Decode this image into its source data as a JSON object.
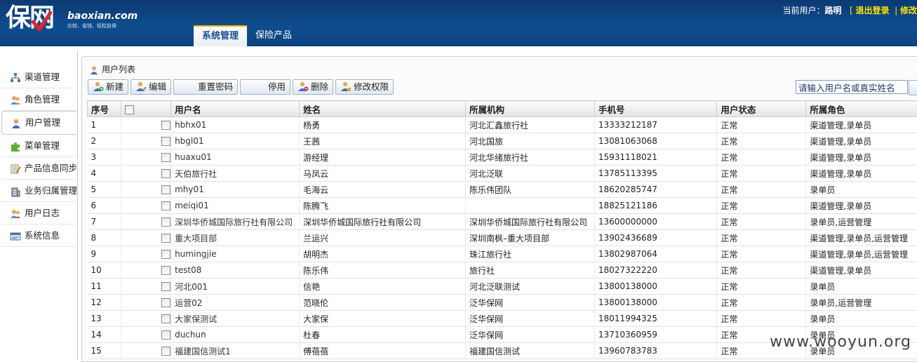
{
  "header": {
    "logo_cn": "保网",
    "logo_en": "baoxian.com",
    "slogan": "比较、省钱、轻松投保",
    "current_user_label": "当前用户：",
    "current_user": "路明",
    "logout": "退出登录",
    "modify_truncated": "修改"
  },
  "nav_tabs": [
    {
      "label": "系统管理",
      "active": true
    },
    {
      "label": "保险产品",
      "active": false
    }
  ],
  "sidebar": {
    "items": [
      {
        "label": "渠道管理",
        "icon": "org-chart-icon"
      },
      {
        "label": "角色管理",
        "icon": "users-icon"
      },
      {
        "label": "用户管理",
        "icon": "user-icon",
        "active": true
      },
      {
        "label": "菜单管理",
        "icon": "puzzle-icon"
      },
      {
        "label": "产品信息同步",
        "icon": "edit-note-icon"
      },
      {
        "label": "业务归属管理",
        "icon": "building-icon"
      },
      {
        "label": "用户日志",
        "icon": "user-log-icon"
      },
      {
        "label": "系统信息",
        "icon": "system-info-icon"
      }
    ]
  },
  "panel": {
    "title": "用户列表",
    "toolbar": {
      "new": "新建",
      "edit": "编辑",
      "reset_password": "重置密码",
      "disable": "停用",
      "delete": "删除",
      "edit_permission": "修改权限"
    },
    "search_placeholder": "请输入用户名或真实姓名"
  },
  "table": {
    "columns": [
      "序号",
      "",
      "用户名",
      "姓名",
      "所属机构",
      "手机号",
      "用户状态",
      "所属角色"
    ],
    "rows": [
      {
        "no": "1",
        "username": "hbhx01",
        "name": "杨勇",
        "org": "河北汇鑫旅行社",
        "phone": "13333212187",
        "status": "正常",
        "role": "渠道管理,录单员"
      },
      {
        "no": "2",
        "username": "hbgl01",
        "name": "王茜",
        "org": "河北国旅",
        "phone": "13081063068",
        "status": "正常",
        "role": "渠道管理,录单员"
      },
      {
        "no": "3",
        "username": "huaxu01",
        "name": "游经理",
        "org": "河北华绪旅行社",
        "phone": "15931118021",
        "status": "正常",
        "role": "渠道管理,录单员"
      },
      {
        "no": "4",
        "username": "天伯旅行社",
        "name": "马凤云",
        "org": "河北泛联",
        "phone": "13785113395",
        "status": "正常",
        "role": "渠道管理,录单员"
      },
      {
        "no": "5",
        "username": "mhy01",
        "name": "毛海云",
        "org": "陈乐伟团队",
        "phone": "18620285747",
        "status": "正常",
        "role": "录单员"
      },
      {
        "no": "6",
        "username": "meiqi01",
        "name": "陈腾飞",
        "org": "",
        "phone": "18825121186",
        "status": "正常",
        "role": "渠道管理,录单员"
      },
      {
        "no": "7",
        "username": "深圳华侨城国际旅行社有限公司",
        "name": "深圳华侨城国际旅行社有限公司",
        "org": "深圳华侨城国际旅行社有限公司",
        "phone": "13600000000",
        "status": "正常",
        "role": "录单员,运营管理"
      },
      {
        "no": "8",
        "username": "重大项目部",
        "name": "兰运兴",
        "org": "深圳南枫–重大项目部",
        "phone": "13902436689",
        "status": "正常",
        "role": "渠道管理,录单员,运营管理"
      },
      {
        "no": "9",
        "username": "humingjie",
        "name": "胡明杰",
        "org": "珠江旅行社",
        "phone": "13802987064",
        "status": "正常",
        "role": "渠道管理,录单员,运营管理"
      },
      {
        "no": "10",
        "username": "test08",
        "name": "陈乐伟",
        "org": "旅行社",
        "phone": "18027322220",
        "status": "正常",
        "role": "渠道管理,录单员"
      },
      {
        "no": "11",
        "username": "河北001",
        "name": "信艳",
        "org": "河北泛联测试",
        "phone": "13800138000",
        "status": "正常",
        "role": "录单员"
      },
      {
        "no": "12",
        "username": "运营02",
        "name": "范晓伦",
        "org": "泛华保网",
        "phone": "13800138000",
        "status": "正常",
        "role": "录单员,运营管理"
      },
      {
        "no": "13",
        "username": "大家保测试",
        "name": "大家保",
        "org": "泛华保网",
        "phone": "18011994325",
        "status": "正常",
        "role": "录单员"
      },
      {
        "no": "14",
        "username": "duchun",
        "name": "杜春",
        "org": "泛华保网",
        "phone": "13710360959",
        "status": "正常",
        "role": "录单员"
      },
      {
        "no": "15",
        "username": "福建国信测试1",
        "name": "傅蓓蓓",
        "org": "福建国信测试",
        "phone": "13960783783",
        "status": "正常",
        "role": "录单员"
      }
    ]
  },
  "watermark": "www.wooyun.org",
  "colors": {
    "header_bg": "#0f4d8f",
    "header_link": "#ffe400",
    "tab_active_accent": "#f7b300",
    "button_border": "#9db3cc"
  }
}
